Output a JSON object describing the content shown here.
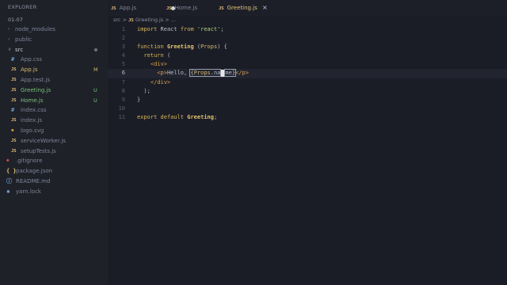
{
  "sidebar": {
    "title": "EXPLORER",
    "project": "01-07",
    "items": [
      {
        "label": "node_modules",
        "kind": "folder",
        "open": false,
        "status": ""
      },
      {
        "label": "public",
        "kind": "folder",
        "open": false,
        "status": ""
      },
      {
        "label": "src",
        "kind": "folder",
        "open": true,
        "status": "dot"
      },
      {
        "label": "App.css",
        "kind": "css",
        "status": ""
      },
      {
        "label": "App.js",
        "kind": "js",
        "status": "M"
      },
      {
        "label": "App.test.js",
        "kind": "js",
        "status": ""
      },
      {
        "label": "Greeting.js",
        "kind": "js",
        "status": "U"
      },
      {
        "label": "Home.js",
        "kind": "js",
        "status": "U"
      },
      {
        "label": "index.css",
        "kind": "css",
        "status": ""
      },
      {
        "label": "index.js",
        "kind": "js",
        "status": ""
      },
      {
        "label": "logo.svg",
        "kind": "svg",
        "status": ""
      },
      {
        "label": "serviceWorker.js",
        "kind": "js",
        "status": ""
      },
      {
        "label": "setupTests.js",
        "kind": "js",
        "status": ""
      },
      {
        "label": ".gitignore",
        "kind": "git",
        "status": ""
      },
      {
        "label": "package.json",
        "kind": "json",
        "status": ""
      },
      {
        "label": "README.md",
        "kind": "md",
        "status": ""
      },
      {
        "label": "yarn.lock",
        "kind": "lock",
        "status": ""
      }
    ]
  },
  "icons": {
    "js": "JS",
    "json": "{ }"
  },
  "tabs": [
    {
      "label": "App.js",
      "active": false,
      "modified": true
    },
    {
      "label": "Home.js",
      "active": false,
      "modified": false
    },
    {
      "label": "Greeting.js",
      "active": true,
      "close": "×"
    }
  ],
  "breadcrumb": {
    "folder": "src",
    "sep": ">",
    "file": "Greeting.js",
    "rest": "> ..."
  },
  "editor": {
    "line_numbers": [
      "1",
      "2",
      "3",
      "4",
      "5",
      "6",
      "7",
      "8",
      "9",
      "10",
      "11"
    ],
    "lines": [
      "import React from 'react';",
      "",
      "function Greeting (Props) {",
      "  return (",
      "    <div>",
      "      <p>Hello, {Props.name}</p>",
      "    </div>",
      "  );",
      "}",
      "",
      "export default Greeting;"
    ],
    "current_line": 6
  },
  "colors": {
    "background": "#1b1d26",
    "sidebar": "#1f2129",
    "js_icon": "#e5c07b",
    "untracked": "#79c07a",
    "modified": "#d9b86a"
  }
}
